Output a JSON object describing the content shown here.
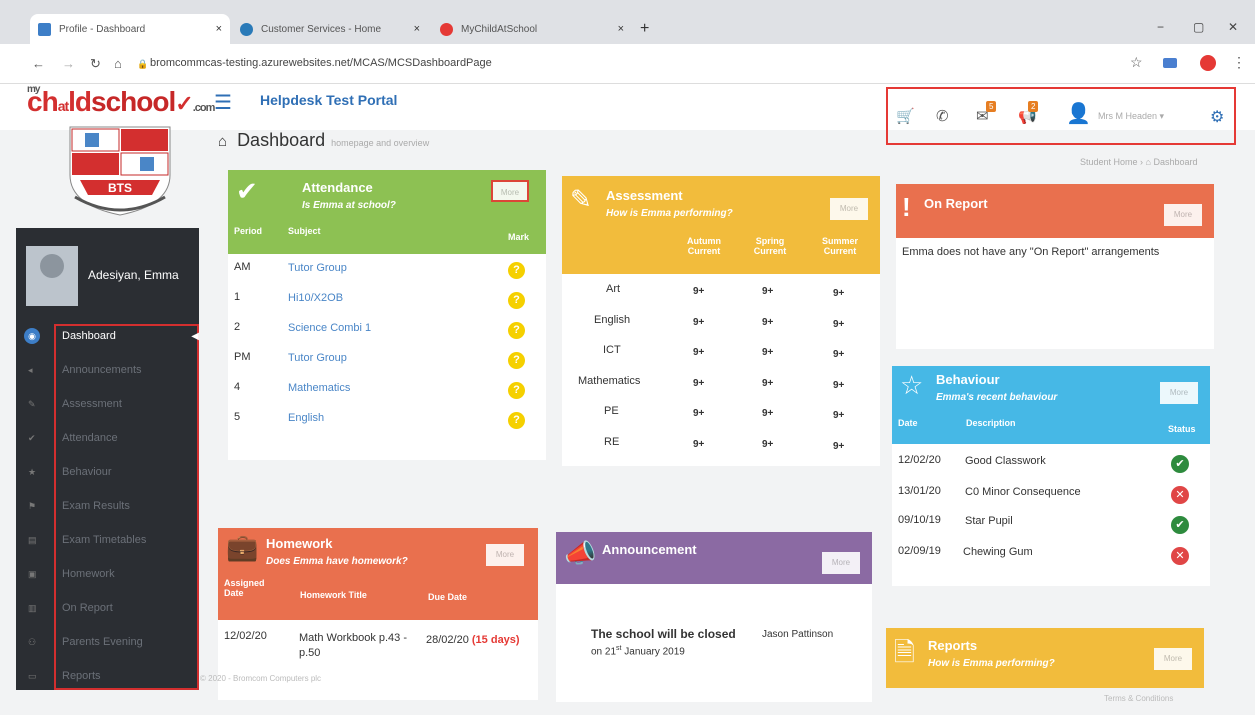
{
  "browser": {
    "tabs": [
      {
        "label": "Profile - Dashboard",
        "color": "#3d7ec7"
      },
      {
        "label": "Customer Services - Home",
        "color": "#2a7ab8"
      },
      {
        "label": "MyChildAtSchool",
        "color": "#e53935"
      }
    ],
    "close_glyph": "×",
    "new_tab_glyph": "+",
    "url": "bromcommcas-testing.azurewebsites.net/MCAS/MCSDashboardPage",
    "win_min": "−",
    "win_max": "▢",
    "win_close": "✕"
  },
  "header": {
    "logo_my": "my",
    "logo_ch": "ch",
    "logo_ld": "ld",
    "logo_at": "at",
    "logo_school": "school",
    "logo_com": ".com",
    "portal_title": "Helpdesk Test Portal",
    "user": "Mrs M Headen ▾",
    "badges": {
      "mail": "5",
      "alerts": "2"
    }
  },
  "crest": {
    "text": "BTS"
  },
  "sidebar": {
    "student_name": "Adesiyan, Emma",
    "items": [
      {
        "label": "Dashboard",
        "icon": "dashboard-icon"
      },
      {
        "label": "Announcements",
        "icon": "megaphone-icon"
      },
      {
        "label": "Assessment",
        "icon": "pencil-icon"
      },
      {
        "label": "Attendance",
        "icon": "check-icon"
      },
      {
        "label": "Behaviour",
        "icon": "star-icon"
      },
      {
        "label": "Exam Results",
        "icon": "flag-icon"
      },
      {
        "label": "Exam Timetables",
        "icon": "calendar-icon"
      },
      {
        "label": "Homework",
        "icon": "briefcase-icon"
      },
      {
        "label": "On Report",
        "icon": "report-icon"
      },
      {
        "label": "Parents Evening",
        "icon": "people-icon"
      },
      {
        "label": "Reports",
        "icon": "file-icon"
      }
    ]
  },
  "page": {
    "title": "Dashboard",
    "subtitle": "homepage and overview",
    "breadcrumb": "Student Home  ›  ⌂ Dashboard"
  },
  "attendance": {
    "title": "Attendance",
    "subtitle": "Is Emma at school?",
    "more": "More",
    "columns": [
      "Period",
      "Subject",
      "Mark"
    ],
    "rows": [
      {
        "period": "AM",
        "subject": "Tutor Group",
        "mark": "?"
      },
      {
        "period": "1",
        "subject": "Hi10/X2OB",
        "mark": "?"
      },
      {
        "period": "2",
        "subject": "Science Combi 1",
        "mark": "?"
      },
      {
        "period": "PM",
        "subject": "Tutor Group",
        "mark": "?"
      },
      {
        "period": "4",
        "subject": "Mathematics",
        "mark": "?"
      },
      {
        "period": "5",
        "subject": "English",
        "mark": "?"
      }
    ],
    "color": "#8dc153"
  },
  "assessment": {
    "title": "Assessment",
    "subtitle": "How is Emma performing?",
    "more": "More",
    "columns": [
      "Autumn Current",
      "Spring Current",
      "Summer Current"
    ],
    "rows": [
      {
        "subject": "Art",
        "a": "9+",
        "b": "9+",
        "c": "9+"
      },
      {
        "subject": "English",
        "a": "9+",
        "b": "9+",
        "c": "9+"
      },
      {
        "subject": "ICT",
        "a": "9+",
        "b": "9+",
        "c": "9+"
      },
      {
        "subject": "Mathematics",
        "a": "9+",
        "b": "9+",
        "c": "9+"
      },
      {
        "subject": "PE",
        "a": "9+",
        "b": "9+",
        "c": "9+"
      },
      {
        "subject": "RE",
        "a": "9+",
        "b": "9+",
        "c": "9+"
      }
    ],
    "color": "#f2bc3c"
  },
  "on_report": {
    "title": "On Report",
    "more": "More",
    "message": "Emma does not have any \"On Report\" arrangements",
    "color": "#e9704e"
  },
  "behaviour": {
    "title": "Behaviour",
    "subtitle": "Emma's recent behaviour",
    "more": "More",
    "columns": [
      "Date",
      "Description",
      "Status"
    ],
    "rows": [
      {
        "date": "12/02/20",
        "desc": "Good Classwork",
        "status": "positive"
      },
      {
        "date": "13/01/20",
        "desc": "C0 Minor Consequence",
        "status": "negative"
      },
      {
        "date": "09/10/19",
        "desc": "Star Pupil",
        "status": "positive"
      },
      {
        "date": "02/09/19",
        "desc": "Chewing Gum",
        "status": "negative"
      }
    ],
    "color": "#46b8e6"
  },
  "homework": {
    "title": "Homework",
    "subtitle": "Does Emma have homework?",
    "more": "More",
    "columns": [
      "Assigned Date",
      "Homework Title",
      "Due Date"
    ],
    "rows": [
      {
        "assigned": "12/02/20",
        "title": "Math Workbook p.43 - p.50",
        "due": "28/02/20",
        "days": "(15 days)"
      }
    ],
    "color": "#e9704e"
  },
  "announcement": {
    "title": "Announcement",
    "more": "More",
    "headline": "The school will be closed",
    "author": "Jason Pattinson",
    "date_pre": "on 21",
    "date_sup": "st",
    "date_post": " January 2019",
    "color": "#8b6aa3"
  },
  "reports": {
    "title": "Reports",
    "subtitle": "How is Emma performing?",
    "more": "More",
    "color": "#f2bc3c"
  },
  "footer": {
    "left": "© 2020 - Bromcom Computers plc",
    "right": "Terms & Conditions"
  }
}
